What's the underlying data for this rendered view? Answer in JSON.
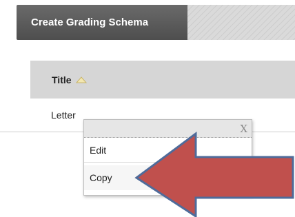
{
  "toolbar": {
    "create_label": "Create Grading Schema"
  },
  "table": {
    "column_header": "Title",
    "sort_icon": "triangle-up-icon",
    "rows": [
      {
        "title": "Letter"
      }
    ]
  },
  "context_menu": {
    "close_label": "X",
    "items": [
      {
        "label": "Edit"
      },
      {
        "label": "Copy"
      }
    ]
  },
  "colors": {
    "button_bg": "#5a5a5a",
    "header_bg": "#d6d6d6",
    "arrow_fill": "#c0504d",
    "arrow_stroke": "#4f6b9a"
  }
}
